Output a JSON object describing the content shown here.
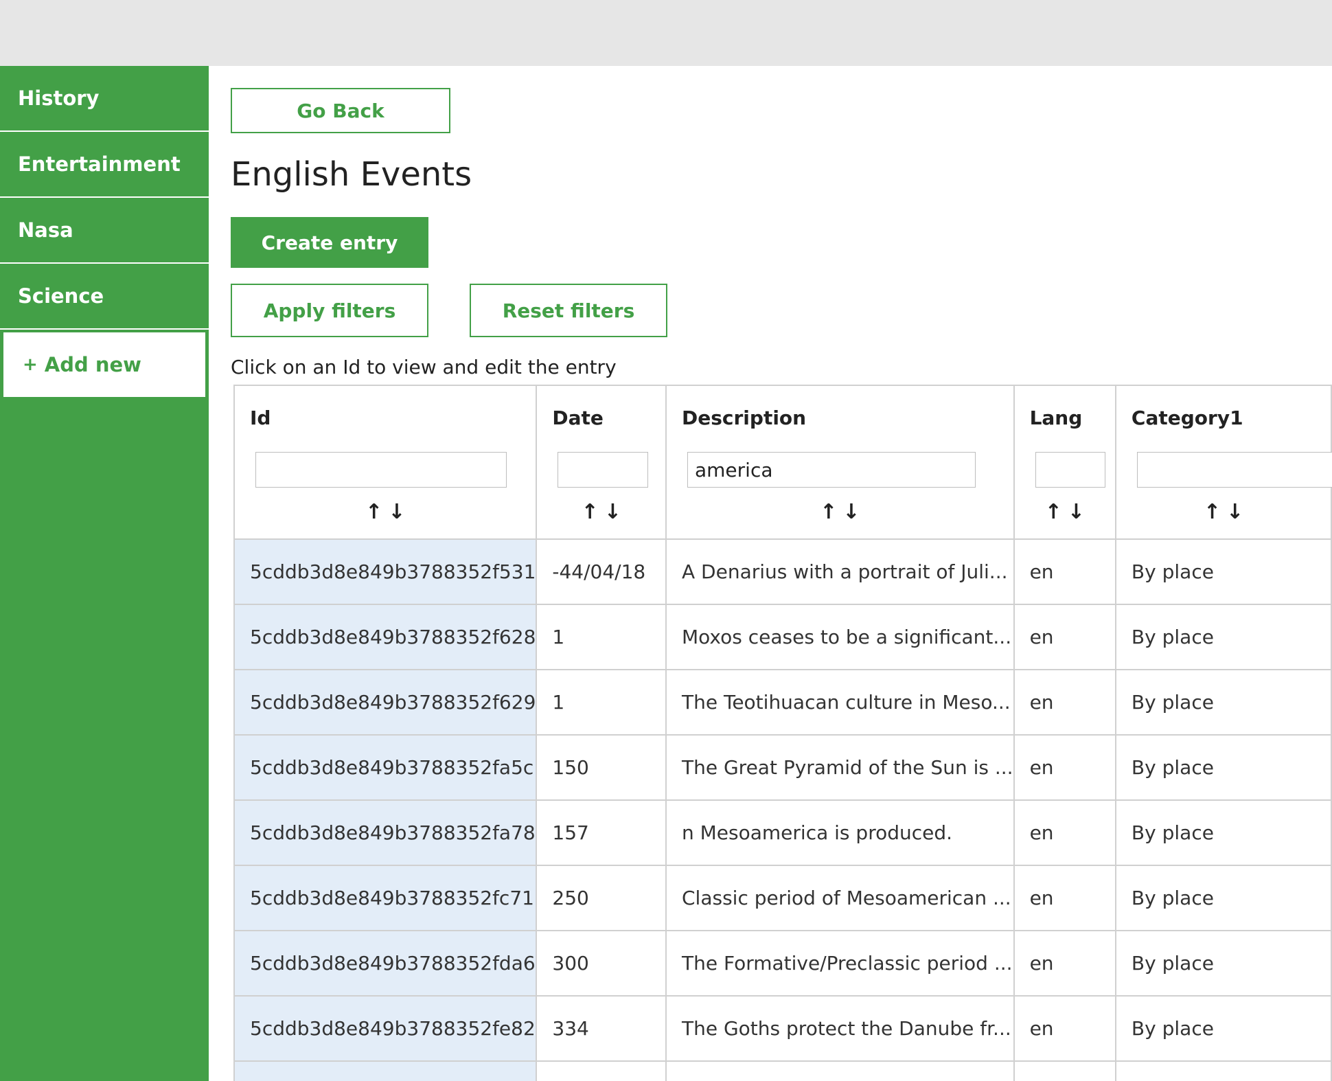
{
  "sidebar": {
    "items": [
      {
        "label": "History"
      },
      {
        "label": "Entertainment"
      },
      {
        "label": "Nasa"
      },
      {
        "label": "Science"
      }
    ],
    "add_plus": "+",
    "add_label": "Add new"
  },
  "main": {
    "go_back": "Go Back",
    "title": "English Events",
    "create": "Create entry",
    "apply_filters": "Apply filters",
    "reset_filters": "Reset filters",
    "hint": "Click on an Id to view and edit the entry"
  },
  "table": {
    "sort_up": "↑",
    "sort_down": "↓",
    "columns": [
      {
        "label": "Id",
        "filter": ""
      },
      {
        "label": "Date",
        "filter": ""
      },
      {
        "label": "Description",
        "filter": "america"
      },
      {
        "label": "Lang",
        "filter": ""
      },
      {
        "label": "Category1",
        "filter": ""
      }
    ],
    "rows": [
      [
        "5cddb3d8e849b3788352f531",
        "-44/04/18",
        "A Denarius with a portrait of Juli...",
        "en",
        "By place"
      ],
      [
        "5cddb3d8e849b3788352f628",
        "1",
        "Moxos ceases to be a significant...",
        "en",
        "By place"
      ],
      [
        "5cddb3d8e849b3788352f629",
        "1",
        "The Teotihuacan culture in Meso...",
        "en",
        "By place"
      ],
      [
        "5cddb3d8e849b3788352fa5c",
        "150",
        "The Great Pyramid of the Sun is ...",
        "en",
        "By place"
      ],
      [
        "5cddb3d8e849b3788352fa78",
        "157",
        "n Mesoamerica is produced.",
        "en",
        "By place"
      ],
      [
        "5cddb3d8e849b3788352fc71",
        "250",
        "Classic period of Mesoamerican ...",
        "en",
        "By place"
      ],
      [
        "5cddb3d8e849b3788352fda6",
        "300",
        "The Formative/Preclassic period ...",
        "en",
        "By place"
      ],
      [
        "5cddb3d8e849b3788352fe82",
        "334",
        "The Goths protect the Danube fr...",
        "en",
        "By place"
      ]
    ]
  },
  "colors": {
    "brand_green": "#43a047",
    "id_cell_bg": "#e3edf8",
    "topbar": "#e6e6e6"
  }
}
